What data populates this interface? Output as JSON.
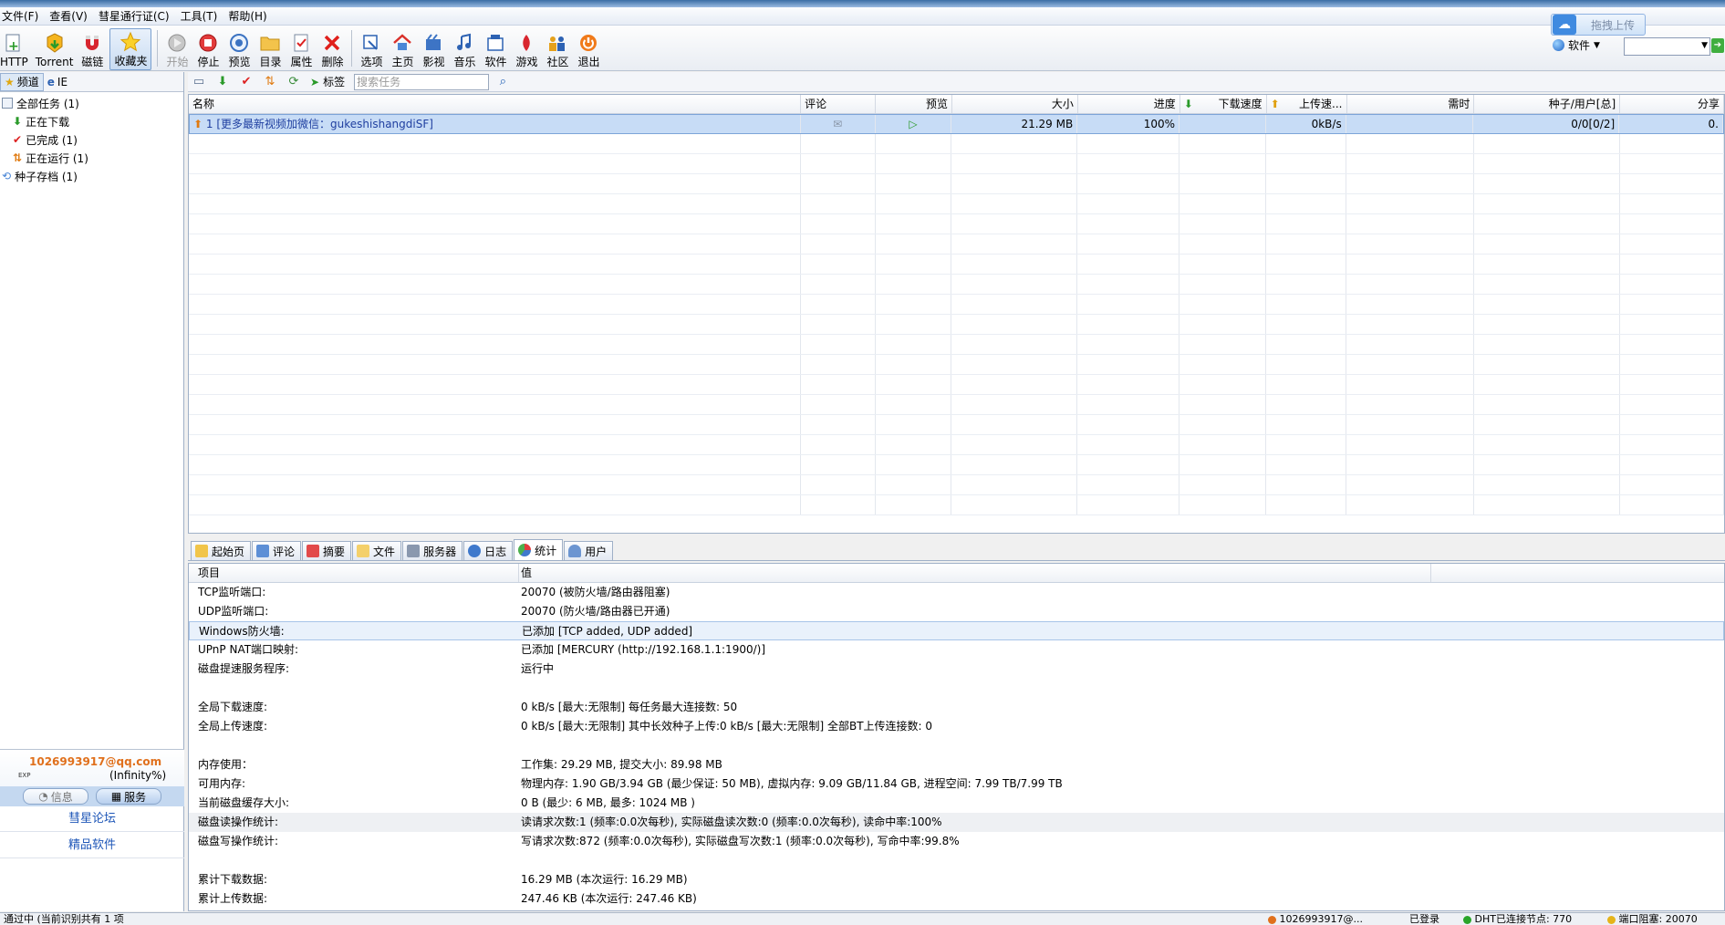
{
  "menu": [
    "文件(F)",
    "查看(V)",
    "彗星通行证(C)",
    "工具(T)",
    "帮助(H)"
  ],
  "toolbar": {
    "http": "HTTP",
    "torrent": "Torrent",
    "magnet": "磁链",
    "favorites": "收藏夹",
    "start": "开始",
    "stop": "停止",
    "preview": "预览",
    "dir": "目录",
    "props": "属性",
    "delete": "删除",
    "options": "选项",
    "home": "主页",
    "video": "影视",
    "music": "音乐",
    "software": "软件",
    "games": "游戏",
    "community": "社区",
    "exit": "退出"
  },
  "cloud": {
    "label": "拖拽上传"
  },
  "software_drop": {
    "label": "软件"
  },
  "left": {
    "tabs": [
      "频道",
      "IE"
    ],
    "tree": [
      {
        "label": "全部任务 (1)",
        "level": 0
      },
      {
        "label": "正在下载",
        "level": 1
      },
      {
        "label": "已完成 (1)",
        "level": 1
      },
      {
        "label": "正在运行 (1)",
        "level": 1
      },
      {
        "label": "种子存档 (1)",
        "level": 0
      }
    ],
    "account": {
      "email": "1026993917@qq.com",
      "exp": "EXP",
      "pct": "(Infinity%)"
    },
    "info_btn": "信息",
    "service_btn": "服务",
    "links": [
      "彗星论坛",
      "精品软件"
    ]
  },
  "list_toolbar": {
    "tag": "标签",
    "search_placeholder": "搜索任务"
  },
  "table": {
    "headers": [
      "名称",
      "评论",
      "预览",
      "大小",
      "进度",
      "下载速度",
      "上传速...",
      "需时",
      "种子/用户[总]",
      "分享"
    ],
    "rows": [
      {
        "name": "1 [更多最新视频加微信：gukeshishangdiSF]",
        "size": "21.29 MB",
        "progress": "100%",
        "up": "0kB/s",
        "peers": "0/0[0/2]",
        "share": "0."
      }
    ]
  },
  "bottom_tabs": [
    "起始页",
    "评论",
    "摘要",
    "文件",
    "服务器",
    "日志",
    "统计",
    "用户"
  ],
  "stats": {
    "head_key": "项目",
    "head_val": "值",
    "rows": [
      {
        "k": "TCP监听端口:",
        "v": "20070 (被防火墙/路由器阻塞)"
      },
      {
        "k": "UDP监听端口:",
        "v": "20070 (防火墙/路由器已开通)"
      },
      {
        "k": "Windows防火墙:",
        "v": "已添加 [TCP added, UDP added]"
      },
      {
        "k": "UPnP NAT端口映射:",
        "v": "已添加 [MERCURY (http://192.168.1.1:1900/)]"
      },
      {
        "k": "磁盘提速服务程序:",
        "v": "运行中"
      },
      {
        "k": "",
        "v": ""
      },
      {
        "k": "全局下载速度:",
        "v": "0 kB/s [最大:无限制]      每任务最大连接数: 50"
      },
      {
        "k": "全局上传速度:",
        "v": "0 kB/s [最大:无限制]      其中长效种子上传:0 kB/s [最大:无限制]      全部BT上传连接数: 0"
      },
      {
        "k": "",
        "v": ""
      },
      {
        "k": "内存使用：",
        "v": "工作集: 29.29 MB, 提交大小: 89.98 MB"
      },
      {
        "k": "可用内存:",
        "v": "物理内存: 1.90 GB/3.94 GB (最少保证: 50 MB), 虚拟内存: 9.09 GB/11.84 GB, 进程空间: 7.99 TB/7.99 TB"
      },
      {
        "k": "当前磁盘缓存大小:",
        "v": "0 B (最少: 6 MB, 最多: 1024 MB )"
      },
      {
        "k": "磁盘读操作统计:",
        "v": "读请求次数:1 (频率:0.0次每秒), 实际磁盘读次数:0 (频率:0.0次每秒), 读命中率:100%"
      },
      {
        "k": "磁盘写操作统计:",
        "v": "写请求次数:872 (频率:0.0次每秒), 实际磁盘写次数:1 (频率:0.0次每秒), 写命中率:99.8%"
      },
      {
        "k": "",
        "v": ""
      },
      {
        "k": "累计下载数据:",
        "v": "16.29 MB (本次运行: 16.29 MB)"
      },
      {
        "k": "累计上传数据:",
        "v": "247.46 KB (本次运行: 247.46 KB)"
      }
    ]
  },
  "status": {
    "left": "通过中 (当前识别共有 1 项",
    "account": "1026993917@...",
    "login": "已登录",
    "dht": "DHT已连接节点: 770",
    "port": "端口阻塞: 20070"
  },
  "colors": {
    "accent": "#3f8ae0",
    "email": "#e0701c",
    "selection": "#c7dcf6"
  }
}
